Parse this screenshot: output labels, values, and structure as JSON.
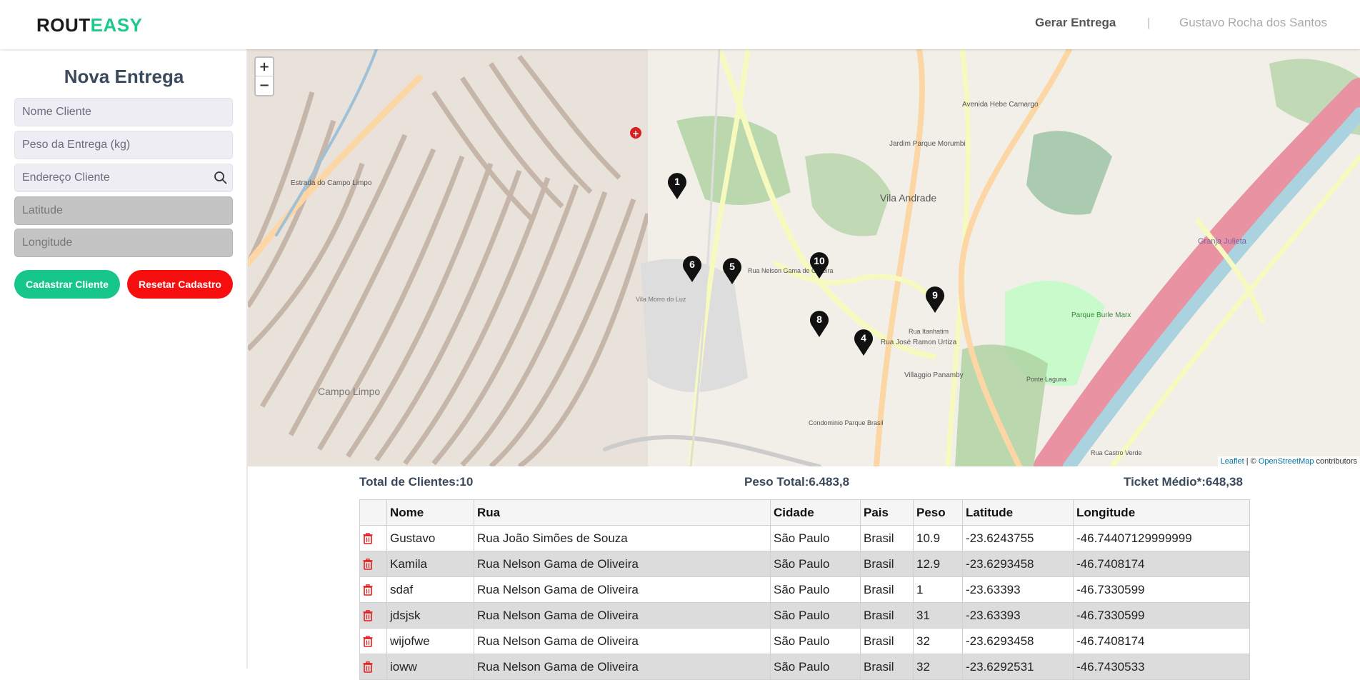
{
  "header": {
    "logo_part1": "ROUT",
    "logo_part2": "EASY",
    "nav_gerar": "Gerar Entrega",
    "nav_separator": "|",
    "user_name": "Gustavo Rocha dos Santos"
  },
  "sidebar": {
    "title": "Nova Entrega",
    "fields": {
      "nome_placeholder": "Nome Cliente",
      "peso_placeholder": "Peso da Entrega (kg)",
      "endereco_placeholder": "Endereço Cliente",
      "latitude_placeholder": "Latitude",
      "longitude_placeholder": "Longitude"
    },
    "btn_cadastrar": "Cadastrar Cliente",
    "btn_resetar": "Resetar Cadastro"
  },
  "map": {
    "zoom_in": "+",
    "zoom_out": "−",
    "attribution_leaflet": "Leaflet",
    "attribution_sep": " | © ",
    "attribution_osm": "OpenStreetMap",
    "attribution_tail": " contributors",
    "markers": [
      "1",
      "6",
      "5",
      "10",
      "9",
      "8",
      "4"
    ],
    "labels": {
      "vila_andrade": "Vila Andrade",
      "campo_limpo": "Campo Limpo",
      "jardim_parque_morumbi": "Jardim Parque Morumbi",
      "parque_burle_marx": "Parque Burle Marx",
      "villaggio_panamby": "Villaggio Panamby",
      "condominio": "Condominio Parque Brasil",
      "granja_julieta": "Granja Julieta",
      "vila_morro_luz": "Vila Morro do Luz",
      "ponte_laguna": "Ponte Laguna",
      "estrada_campo_limpo": "Estrada do Campo Limpo",
      "avenida_hebe": "Avenida Hebe Camargo",
      "rua_jose_ramon": "Rua José Ramon Urtiza",
      "rua_nelson": "Rua Nelson Gama de Oliveira",
      "rua_itanhatim": "Rua Itanhatim",
      "rua_castro_verde": "Rua Castro Verde"
    },
    "colors": {
      "green": "#add19e",
      "park": "#c8facc",
      "highway": "#e892a2",
      "water": "#aad3df",
      "primary": "#fcd6a4",
      "secondary": "#f7fabf",
      "urban": "#c2b2a4"
    }
  },
  "stats": {
    "total_clientes": "Total de Clientes:10",
    "peso_total": "Peso Total:6.483,8",
    "ticket_medio": "Ticket Médio*:648,38"
  },
  "table": {
    "headers": [
      "",
      "Nome",
      "Rua",
      "Cidade",
      "Pais",
      "Peso",
      "Latitude",
      "Longitude"
    ],
    "rows": [
      [
        "Gustavo",
        "Rua João Simões de Souza",
        "São Paulo",
        "Brasil",
        "10.9",
        "-23.6243755",
        "-46.74407129999999"
      ],
      [
        "Kamila",
        "Rua Nelson Gama de Oliveira",
        "São Paulo",
        "Brasil",
        "12.9",
        "-23.6293458",
        "-46.7408174"
      ],
      [
        "sdaf",
        "Rua Nelson Gama de Oliveira",
        "São Paulo",
        "Brasil",
        "1",
        "-23.63393",
        "-46.7330599"
      ],
      [
        "jdsjsk",
        "Rua Nelson Gama de Oliveira",
        "São Paulo",
        "Brasil",
        "31",
        "-23.63393",
        "-46.7330599"
      ],
      [
        "wijofwe",
        "Rua Nelson Gama de Oliveira",
        "São Paulo",
        "Brasil",
        "32",
        "-23.6293458",
        "-46.7408174"
      ],
      [
        "ioww",
        "Rua Nelson Gama de Oliveira",
        "São Paulo",
        "Brasil",
        "32",
        "-23.6292531",
        "-46.7430533"
      ]
    ]
  }
}
